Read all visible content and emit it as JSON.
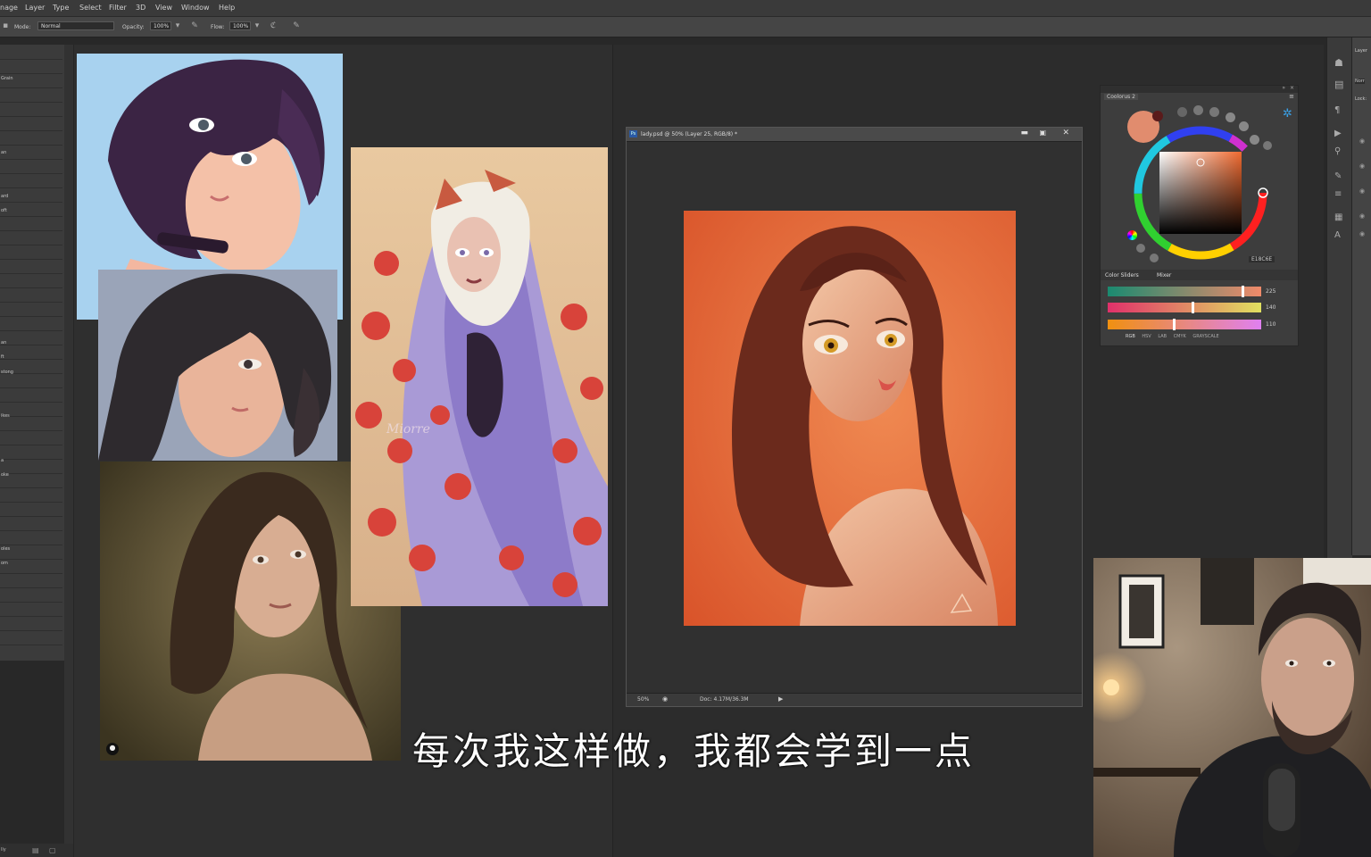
{
  "menu": {
    "items": [
      "nage",
      "Layer",
      "Type",
      "Select",
      "Filter",
      "3D",
      "View",
      "Window",
      "Help"
    ]
  },
  "options": {
    "mode_label": "Mode:",
    "mode_value": "Normal",
    "opacity_label": "Opacity:",
    "opacity_value": "100%",
    "flow_label": "Flow:",
    "flow_value": "100%"
  },
  "left_panel": {
    "labels": [
      "Grain",
      "an",
      "ard",
      "oft",
      "an",
      "ft",
      "stong",
      "ikes",
      "a",
      "oke",
      "oles",
      "om",
      "lly"
    ]
  },
  "document": {
    "title": "lady.psd @ 50% (Layer 25, RGB/8) *",
    "zoom": "50%",
    "doc_size": "Doc: 4.17M/36.3M"
  },
  "reference": {
    "signature": "Miorre"
  },
  "coolorus": {
    "title": "Coolorus 2",
    "hex": "E18C6E",
    "tabs": [
      "Color Sliders",
      "Mixer"
    ],
    "sliders": [
      {
        "value": "225",
        "level": 0.88
      },
      {
        "value": "140",
        "level": 0.55
      },
      {
        "value": "110",
        "level": 0.43
      }
    ],
    "modes": [
      "RGB",
      "HSV",
      "LAB",
      "CMYK",
      "GRAYSCALE"
    ],
    "swatch_color": "#e18c6e"
  },
  "right_dock": {
    "labels": [
      "Layer",
      "Norr",
      "Lock:"
    ]
  },
  "subtitle": "每次我这样做，我都会学到一点"
}
